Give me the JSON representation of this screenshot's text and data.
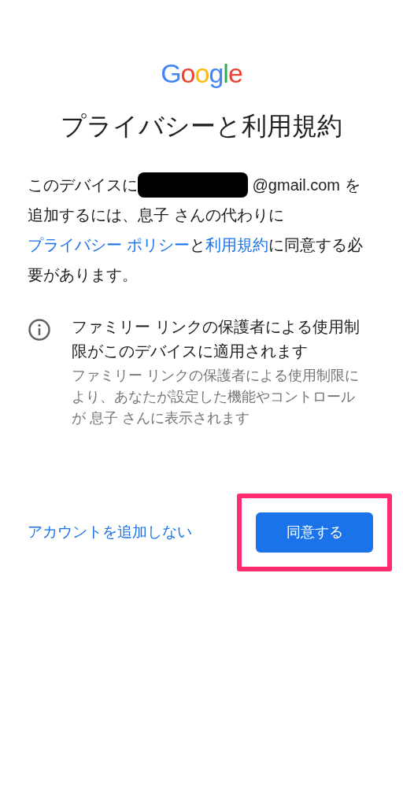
{
  "logo": [
    {
      "text": "G",
      "color": "#4285f4"
    },
    {
      "text": "o",
      "color": "#ea4335"
    },
    {
      "text": "o",
      "color": "#fbbc05"
    },
    {
      "text": "g",
      "color": "#4285f4"
    },
    {
      "text": "l",
      "color": "#34a853"
    },
    {
      "text": "e",
      "color": "#ea4335"
    }
  ],
  "title": "プライバシーと利用規約",
  "paragraph": [
    {
      "kind": "text",
      "text": "このデバイスに"
    },
    {
      "kind": "redacted"
    },
    {
      "kind": "text",
      "text": " @gmail.com を追加するには、息子 さんの代わりに"
    },
    {
      "kind": "link",
      "text": "プライバシー ポリシー"
    },
    {
      "kind": "text",
      "text": "と"
    },
    {
      "kind": "link",
      "text": "利用規約"
    },
    {
      "kind": "text",
      "text": "に同意する必要があります。"
    }
  ],
  "notice": {
    "title": "ファミリー リンクの保護者による使用制限がこのデバイスに適用されます",
    "detail": "ファミリー リンクの保護者による使用制限により、あなたが設定した機能やコントロールが 息子 さんに表示されます"
  },
  "actions": {
    "secondary": "アカウントを追加しない",
    "primary": "同意する",
    "highlighted": true
  }
}
